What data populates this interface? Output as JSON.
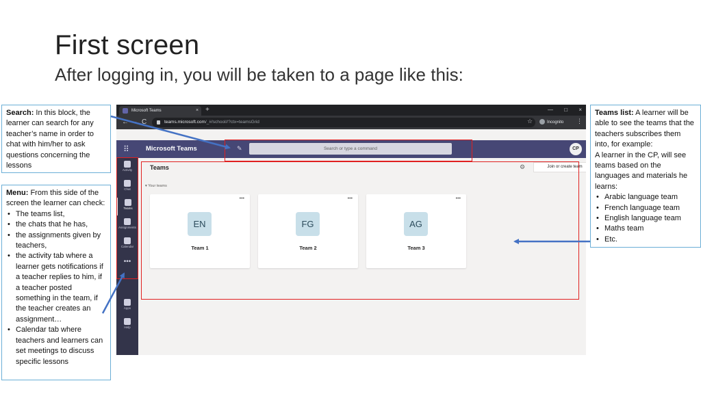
{
  "slide": {
    "title": "First screen",
    "subtitle": "After logging in, you will be taken to a page like this:"
  },
  "callouts": {
    "search": {
      "heading": "Search:",
      "text": " In this block, the learner can search for any teacher’s name in order to chat with him/her to ask questions concerning the lessons"
    },
    "menu": {
      "heading": "Menu:",
      "text": " From this side of the screen the learner can check:",
      "items": [
        "The teams list,",
        "the chats that he has,",
        "the assignments given by teachers,",
        "the activity tab where a learner gets notifications if a teacher replies to him, if a teacher posted something in the team, if the teacher creates an assignment…",
        "Calendar tab where teachers and learners can set meetings to discuss specific lessons"
      ]
    },
    "teams_list": {
      "heading": "Teams list:",
      "text": " A learner will be able to see the teams that the teachers subscribes them into, for example:",
      "text2": "A learner in the CP, will see teams based on the languages and materials he learns:",
      "items": [
        "Arabic language team",
        "French language team",
        "English language team",
        "Maths team",
        "Etc."
      ]
    }
  },
  "browser": {
    "tab_title": "Microsoft Teams",
    "tab_close": "×",
    "new_tab": "+",
    "window_controls": [
      "—",
      "□",
      "×"
    ],
    "nav": [
      "←",
      "→",
      "C"
    ],
    "url_host": "teams.microsoft.com",
    "url_path": "/_#/school//?ctx=teamsGrid",
    "incognito_label": "Incognito"
  },
  "teams_app": {
    "app_name": "Microsoft Teams",
    "search_placeholder": "Search or type a command",
    "avatar_initials": "CP",
    "rail": [
      {
        "label": "Activity"
      },
      {
        "label": "Chat"
      },
      {
        "label": "Teams"
      },
      {
        "label": "Assignments"
      },
      {
        "label": "Calendar"
      }
    ],
    "rail_more": "•••",
    "rail_bottom": [
      {
        "label": "Apps"
      },
      {
        "label": "Help"
      }
    ],
    "page_title": "Teams",
    "join_button": "Join or create team",
    "section_label": "Your teams",
    "teams": [
      {
        "initials": "EN",
        "name": "Team 1"
      },
      {
        "initials": "FG",
        "name": "Team 2"
      },
      {
        "initials": "AG",
        "name": "Team 3"
      }
    ],
    "card_more": "•••"
  },
  "colors": {
    "highlight": "#e02020",
    "arrow": "#4472c4",
    "callout_border": "#6aaed6",
    "teams_header": "#464775",
    "teams_rail": "#33344a"
  }
}
